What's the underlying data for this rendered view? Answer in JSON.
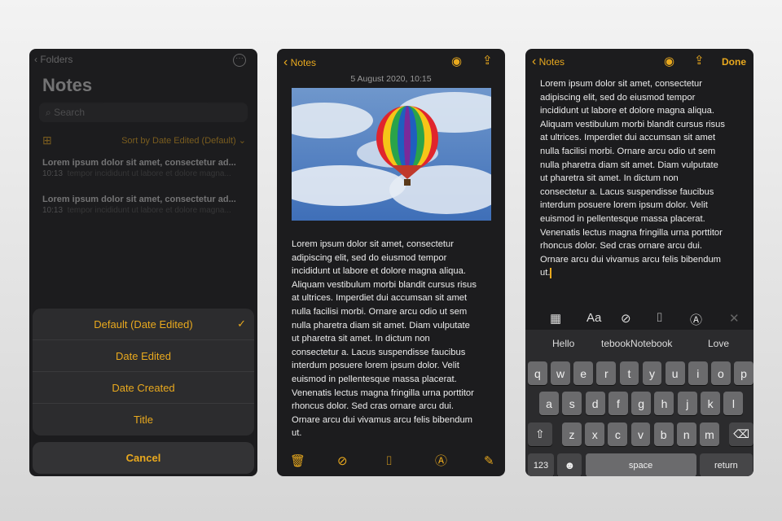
{
  "panel1": {
    "back": "Folders",
    "title": "Notes",
    "search_placeholder": "Search",
    "sort": "Sort by Date Edited (Default)",
    "notes": [
      {
        "title": "Lorem ipsum dolor sit amet, consectetur ad...",
        "time": "10:13",
        "preview": "tempor incididunt ut labore et dolore magna..."
      },
      {
        "title": "Lorem ipsum dolor sit amet, consectetur ad...",
        "time": "10:13",
        "preview": "tempor incididunt ut labore et dolore magna..."
      }
    ],
    "sheet": {
      "options": [
        "Default (Date Edited)",
        "Date Edited",
        "Date Created",
        "Title"
      ],
      "selected": "Default (Date Edited)",
      "cancel": "Cancel"
    }
  },
  "panel2": {
    "back": "Notes",
    "date": "5 August 2020, 10:15"
  },
  "panel3": {
    "back": "Notes",
    "done": "Done",
    "suggestions": [
      "Hello",
      "tebookNotebook",
      "Love"
    ],
    "keys": {
      "row1": [
        "q",
        "w",
        "e",
        "r",
        "t",
        "y",
        "u",
        "i",
        "o",
        "p"
      ],
      "row2": [
        "a",
        "s",
        "d",
        "f",
        "g",
        "h",
        "j",
        "k",
        "l"
      ],
      "row3": [
        "z",
        "x",
        "c",
        "v",
        "b",
        "n",
        "m"
      ],
      "num": "123",
      "space": "space",
      "return": "return"
    }
  },
  "note_lines": [
    "Lorem ipsum dolor sit amet, consectetur",
    "adipiscing elit, sed do eiusmod tempor",
    "incididunt ut labore et dolore magna aliqua.",
    "Aliquam vestibulum morbi blandit cursus risus",
    "at ultrices. Imperdiet dui accumsan sit amet",
    "nulla facilisi morbi. Ornare arcu odio ut sem",
    "nulla pharetra diam sit amet. Diam vulputate",
    "ut pharetra sit amet. In dictum non",
    "consectetur a. Lacus suspendisse faucibus",
    "interdum posuere lorem ipsum dolor. Velit",
    "euismod in pellentesque massa placerat.",
    "Venenatis lectus magna fringilla urna porttitor",
    "rhoncus dolor. Sed cras ornare arcu dui.",
    "Ornare arcu dui vivamus arcu felis bibendum",
    "ut."
  ],
  "colors": {
    "accent": "#e9a91e",
    "background": "#1c1c1e",
    "sheet": "#2c2c2e"
  }
}
